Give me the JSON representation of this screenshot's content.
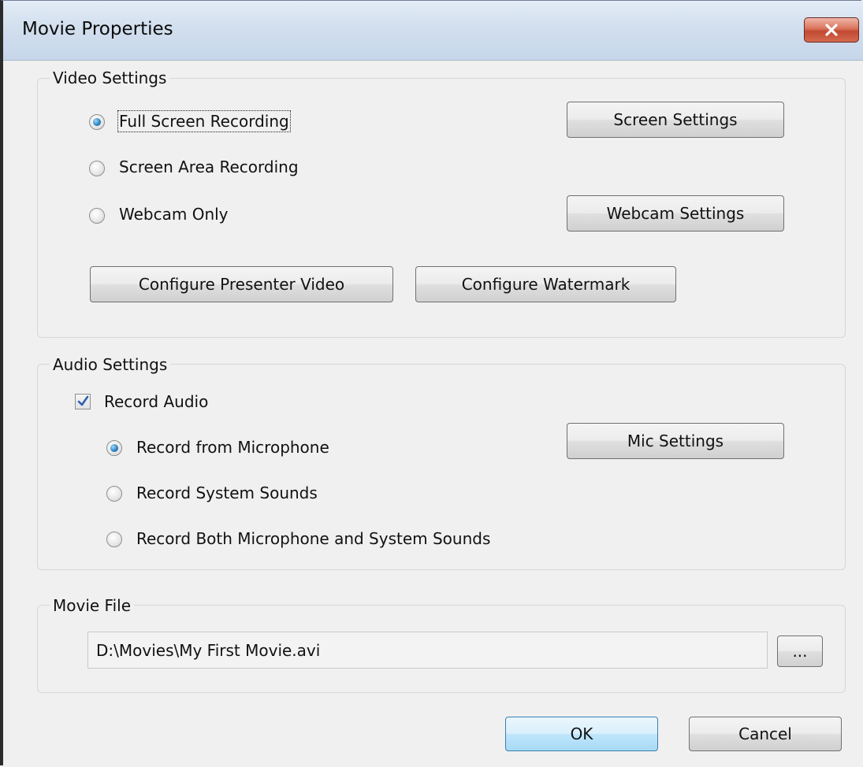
{
  "window": {
    "title": "Movie Properties",
    "close_label": "✕"
  },
  "video": {
    "group_label": "Video Settings",
    "options": [
      {
        "label": "Full Screen Recording",
        "selected": true
      },
      {
        "label": "Screen Area Recording",
        "selected": false
      },
      {
        "label": "Webcam Only",
        "selected": false
      }
    ],
    "screen_settings_label": "Screen Settings",
    "webcam_settings_label": "Webcam Settings",
    "configure_presenter_label": "Configure Presenter Video",
    "configure_watermark_label": "Configure Watermark"
  },
  "audio": {
    "group_label": "Audio Settings",
    "record_audio_label": "Record Audio",
    "record_audio_checked": true,
    "options": [
      {
        "label": "Record from Microphone",
        "selected": true
      },
      {
        "label": "Record System Sounds",
        "selected": false
      },
      {
        "label": "Record Both Microphone and System Sounds",
        "selected": false
      }
    ],
    "mic_settings_label": "Mic Settings"
  },
  "movie_file": {
    "group_label": "Movie File",
    "path": "D:\\Movies\\My First Movie.avi",
    "browse_label": "..."
  },
  "footer": {
    "ok_label": "OK",
    "cancel_label": "Cancel"
  },
  "colors": {
    "titlebar": "#d2dfee",
    "close_button": "#c24a31",
    "default_button_border": "#3c7fb1",
    "radio_selected": "#2c86c7"
  }
}
